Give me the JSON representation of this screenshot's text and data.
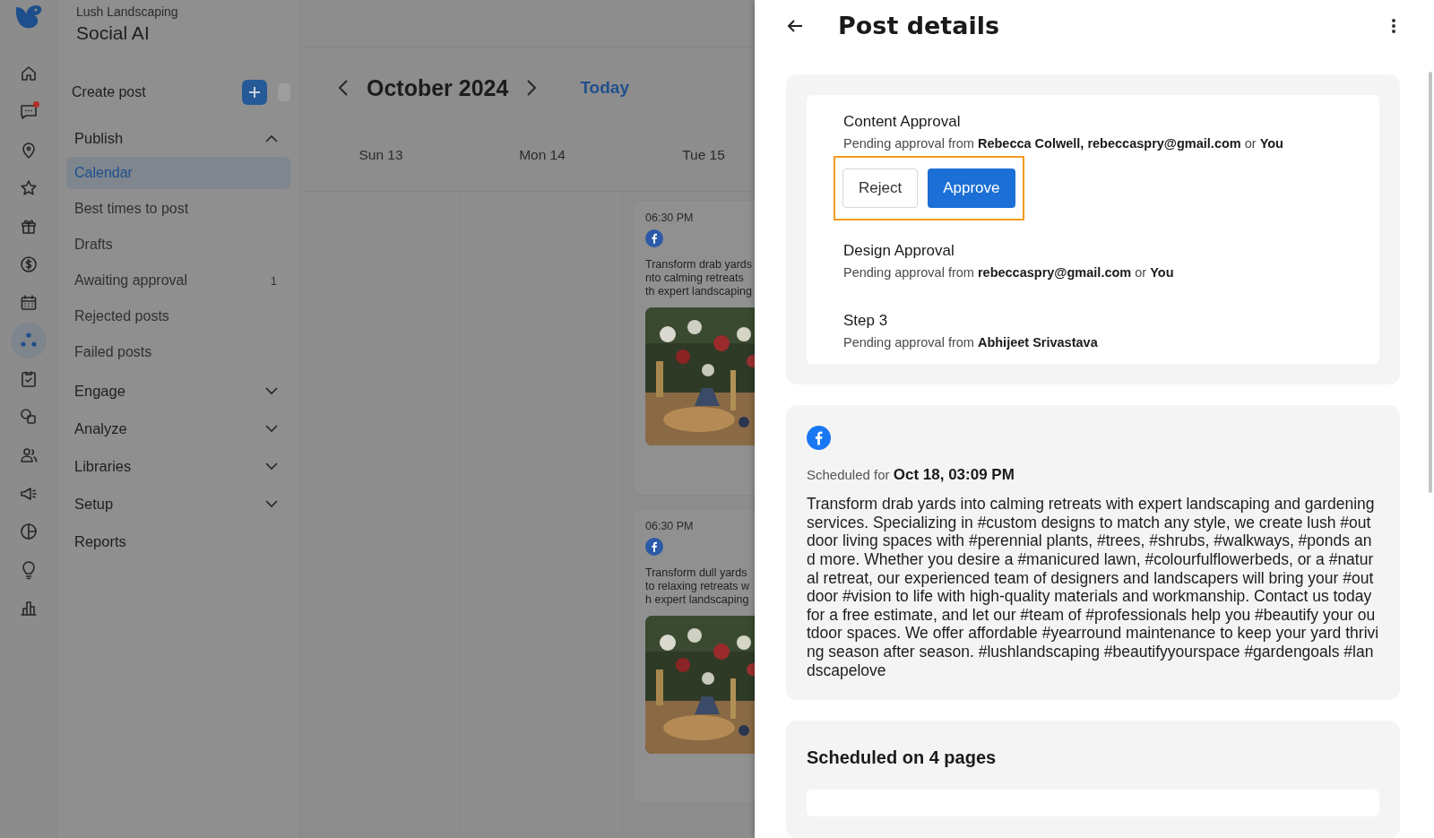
{
  "rail": {
    "items": [
      {
        "kind": "home",
        "selected": false,
        "badge": false
      },
      {
        "kind": "chat",
        "selected": false,
        "badge": true
      },
      {
        "kind": "pin",
        "selected": false,
        "badge": false
      },
      {
        "kind": "star",
        "selected": false,
        "badge": false
      },
      {
        "kind": "gift",
        "selected": false,
        "badge": false
      },
      {
        "kind": "dollar",
        "selected": false,
        "badge": false
      },
      {
        "kind": "calendar",
        "selected": false,
        "badge": false
      },
      {
        "kind": "dots",
        "selected": true,
        "badge": false
      },
      {
        "kind": "clipboard",
        "selected": false,
        "badge": false
      },
      {
        "kind": "shapes",
        "selected": false,
        "badge": false
      },
      {
        "kind": "people",
        "selected": false,
        "badge": false
      },
      {
        "kind": "megaphone",
        "selected": false,
        "badge": false
      },
      {
        "kind": "pie",
        "selected": false,
        "badge": false
      },
      {
        "kind": "bulb",
        "selected": false,
        "badge": false
      },
      {
        "kind": "bars",
        "selected": false,
        "badge": false
      }
    ]
  },
  "nav": {
    "workspace": "Lush Landscaping",
    "title": "Social AI",
    "create_label": "Create post",
    "sections": [
      {
        "label": "Publish",
        "expanded": true,
        "children": [
          {
            "label": "Calendar",
            "selected": true
          },
          {
            "label": "Best times to post",
            "selected": false
          },
          {
            "label": "Drafts",
            "selected": false
          },
          {
            "label": "Awaiting approval",
            "selected": false,
            "count": "1"
          },
          {
            "label": "Rejected posts",
            "selected": false
          },
          {
            "label": "Failed posts",
            "selected": false
          }
        ]
      },
      {
        "label": "Engage",
        "expanded": false
      },
      {
        "label": "Analyze",
        "expanded": false
      },
      {
        "label": "Libraries",
        "expanded": false
      },
      {
        "label": "Setup",
        "expanded": false
      },
      {
        "label": "Reports"
      }
    ]
  },
  "calendar": {
    "month": "October 2024",
    "today": "Today",
    "days": [
      "Sun 13",
      "Mon 14",
      "Tue 15"
    ],
    "posts": [
      {
        "time": "06:30 PM",
        "lines": [
          "Transform drab yards",
          "nto calming retreats",
          "th expert landscaping"
        ]
      },
      {
        "time": "06:30 PM",
        "lines": [
          "Transform dull yards",
          "to relaxing retreats w",
          "h expert landscaping"
        ]
      }
    ]
  },
  "drawer": {
    "title": "Post details",
    "approvals": [
      {
        "name": "Content Approval",
        "detail": "Pending approval from **Rebecca Colwell, rebeccaspry@gmail.com** or **You**",
        "actions": [
          "Reject",
          "Approve"
        ],
        "highlighted": true
      },
      {
        "name": "Design Approval",
        "detail": "Pending approval from **rebeccaspry@gmail.com** or **You**"
      },
      {
        "name": "Step 3",
        "detail": "Pending approval from **Abhijeet Srivastava**"
      }
    ],
    "post": {
      "scheduled_label": "Scheduled for",
      "scheduled_time": "Oct 18, 03:09 PM",
      "text": "Transform drab yards into calming retreats with expert landscaping and gardening services. Specializing in #custom designs to match any style, we create lush #outdoor living spaces with #perennial plants, #trees, #shrubs, #walkways, #ponds and more. Whether you desire a #manicured lawn, #colourfulflowerbeds, or a #natural retreat, our experienced team of designers and landscapers will bring your #outdoor #vision to life with high-quality materials and workmanship. Contact us today for a free estimate, and let our #team of #professionals help you #beautify your outdoor spaces. We offer affordable #yearround maintenance to keep your yard thriving season after season. #lushlandscaping #beautifyyourspace #gardengoals #landscapelove"
    },
    "pages_title": "Scheduled on 4 pages"
  }
}
